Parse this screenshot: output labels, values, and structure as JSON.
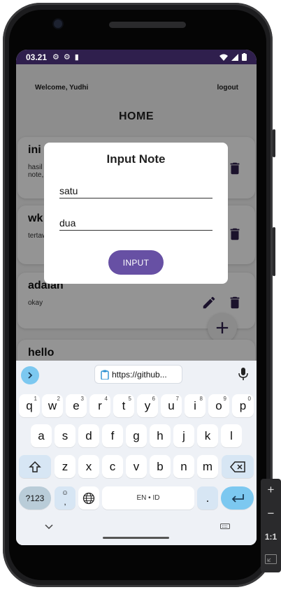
{
  "status_bar": {
    "time": "03.21"
  },
  "app": {
    "welcome": "Welcome, Yudhi",
    "logout": "logout",
    "title": "HOME",
    "notes": [
      {
        "title": "ini",
        "body": "hasil akan note, ..."
      },
      {
        "title": "wk",
        "body": "tertaw"
      },
      {
        "title": "adalah",
        "body": "okay"
      },
      {
        "title": "hello",
        "body": ""
      }
    ]
  },
  "dialog": {
    "title": "Input Note",
    "field1_value": "satu",
    "field2_value": "dua",
    "button_label": "INPUT"
  },
  "keyboard": {
    "clipboard_text": "https://github...",
    "row1": [
      "q",
      "w",
      "e",
      "r",
      "t",
      "y",
      "u",
      "i",
      "o",
      "p"
    ],
    "row1_hints": [
      "1",
      "2",
      "3",
      "4",
      "5",
      "6",
      "7",
      "8",
      "9",
      "0"
    ],
    "row2": [
      "a",
      "s",
      "d",
      "f",
      "g",
      "h",
      "j",
      "k",
      "l"
    ],
    "row3": [
      "z",
      "x",
      "c",
      "v",
      "b",
      "n",
      "m"
    ],
    "sym_label": "?123",
    "emoji_comma": ",",
    "space_label": "EN • ID",
    "period": "."
  },
  "emulator": {
    "zoom_plus": "+",
    "zoom_minus": "−",
    "ratio": "1:1"
  },
  "colors": {
    "status_bar": "#2f1f4d",
    "accent": "#6750a4",
    "icon": "#2f1f4d",
    "keyboard_accent": "#7cc8f0"
  }
}
